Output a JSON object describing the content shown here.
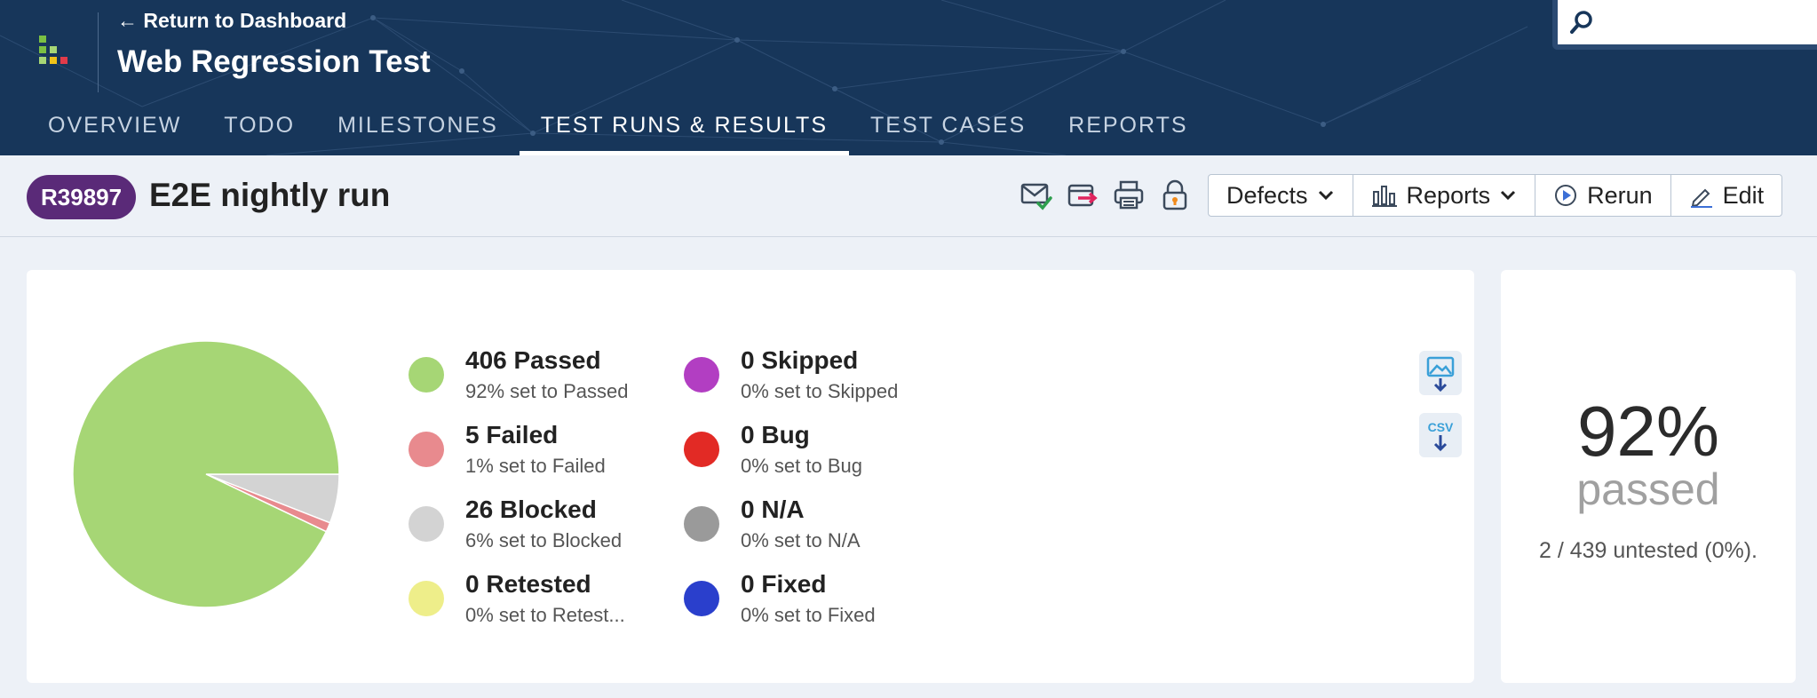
{
  "header": {
    "back_link": "← Return to Dashboard",
    "project_title": "Web Regression Test",
    "search_placeholder": ""
  },
  "nav": {
    "tabs": [
      {
        "label": "OVERVIEW"
      },
      {
        "label": "TODO"
      },
      {
        "label": "MILESTONES"
      },
      {
        "label": "TEST RUNS & RESULTS",
        "active": true
      },
      {
        "label": "TEST CASES"
      },
      {
        "label": "REPORTS"
      }
    ]
  },
  "run": {
    "id": "R39897",
    "title": "E2E nightly run"
  },
  "toolbar": {
    "icons": [
      "email-check-icon",
      "export-icon",
      "print-icon",
      "lock-icon"
    ],
    "defects_label": "Defects",
    "reports_label": "Reports",
    "rerun_label": "Rerun",
    "edit_label": "Edit"
  },
  "legend": [
    {
      "title": "406 Passed",
      "sub": "92% set to Passed",
      "color": "#a6d675"
    },
    {
      "title": "5 Failed",
      "sub": "1% set to Failed",
      "color": "#e88a8e"
    },
    {
      "title": "26 Blocked",
      "sub": "6% set to Blocked",
      "color": "#d3d3d3"
    },
    {
      "title": "0 Retested",
      "sub": "0% set to Retest...",
      "color": "#eeee8a"
    },
    {
      "title": "0 Skipped",
      "sub": "0% set to Skipped",
      "color": "#b23ec2"
    },
    {
      "title": "0 Bug",
      "sub": "0% set to Bug",
      "color": "#e22a25"
    },
    {
      "title": "0 N/A",
      "sub": "0% set to N/A",
      "color": "#9a9a9a"
    },
    {
      "title": "0 Fixed",
      "sub": "0% set to Fixed",
      "color": "#2a3fcc"
    }
  ],
  "export": {
    "csv_label": "CSV"
  },
  "summary": {
    "percent": "92%",
    "label": "passed",
    "untested": "2 / 439 untested (0%)."
  },
  "chart_data": {
    "type": "pie",
    "categories": [
      "Passed",
      "Failed",
      "Blocked",
      "Retested",
      "Skipped",
      "Bug",
      "N/A",
      "Fixed"
    ],
    "values": [
      406,
      5,
      26,
      0,
      0,
      0,
      0,
      0
    ],
    "colors": [
      "#a6d675",
      "#e88a8e",
      "#d3d3d3",
      "#eeee8a",
      "#b23ec2",
      "#e22a25",
      "#9a9a9a",
      "#2a3fcc"
    ],
    "title": ""
  }
}
